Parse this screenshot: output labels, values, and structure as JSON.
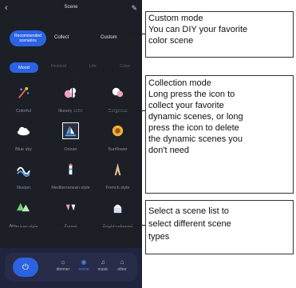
{
  "phone": {
    "title": "Scene",
    "back_icon": "chevron-left-icon",
    "edit_icon": "pencil-icon",
    "tabs": [
      {
        "label": "Recommended scenarios",
        "active": true
      },
      {
        "label": "Collect",
        "active": false
      },
      {
        "label": "Custom",
        "active": false
      }
    ],
    "categories": [
      {
        "label": "Mood",
        "active": true
      },
      {
        "label": "Festival",
        "active": false
      },
      {
        "label": "Life",
        "active": false
      },
      {
        "label": "Color",
        "active": false
      }
    ],
    "scenes": [
      {
        "label": "Colorful",
        "icon": "firework-icon"
      },
      {
        "label": "Illusory color",
        "icon": "bubbles-icon"
      },
      {
        "label": "Gorgeous",
        "icon": "gorgeous-icon"
      },
      {
        "label": "Blue sky",
        "icon": "cloud-icon"
      },
      {
        "label": "Ocean",
        "icon": "sailboat-icon",
        "selected": true
      },
      {
        "label": "Sunflower",
        "icon": "sunflower-icon"
      },
      {
        "label": "Illusion",
        "icon": "waves-icon"
      },
      {
        "label": "Mediterranean style",
        "icon": "lighthouse-icon"
      },
      {
        "label": "French style",
        "icon": "eiffel-tower-icon"
      },
      {
        "label": "American style",
        "icon": "pine-trees-icon"
      },
      {
        "label": "Forest",
        "icon": "drinks-icon"
      },
      {
        "label": "Bright-coloured",
        "icon": "building-icon"
      }
    ],
    "bottom_nav": [
      {
        "label": "dimmer",
        "icon": "dimmer-icon",
        "active": false
      },
      {
        "label": "scene",
        "icon": "scene-icon",
        "active": true
      },
      {
        "label": "music",
        "icon": "music-icon",
        "active": false
      },
      {
        "label": "other",
        "icon": "other-icon",
        "active": false
      }
    ],
    "power_icon": "power-icon"
  },
  "annotations": {
    "custom": [
      "Custom mode",
      "You can DIY your favorite",
      "color scene"
    ],
    "collection": [
      "Collection mode",
      "Long press the icon to",
      "collect your favorite",
      "dynamic scenes, or long",
      "press the icon to delete",
      "the dynamic scenes you",
      "don't need"
    ],
    "scene_list": [
      "Select a scene list to",
      "select different scene",
      "types"
    ]
  },
  "colors": {
    "accent": "#2c63e3",
    "background": "#1c1f26",
    "nav_bar": "#20243d"
  }
}
